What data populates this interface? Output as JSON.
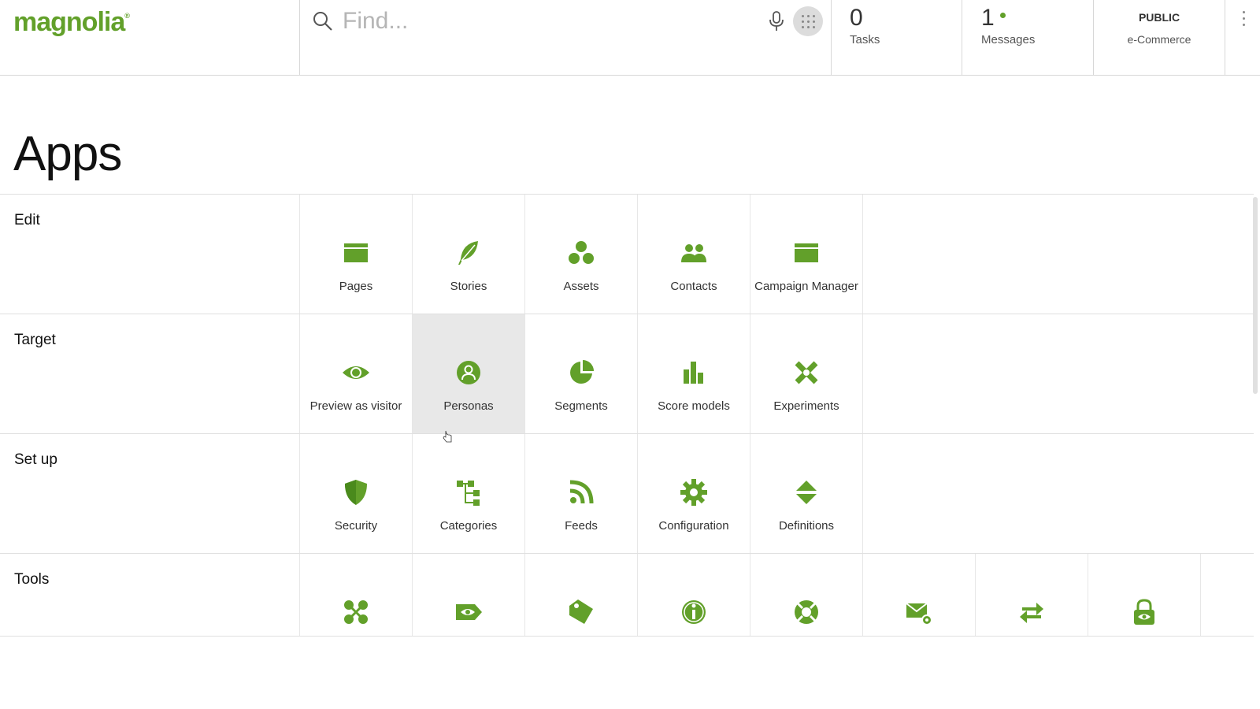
{
  "header": {
    "logo_text": "magnolia",
    "logo_mark": "®",
    "search": {
      "placeholder": "Find...",
      "value": ""
    },
    "tasks": {
      "count": "0",
      "label": "Tasks"
    },
    "messages": {
      "count": "1",
      "label": "Messages"
    },
    "environment": {
      "label": "PUBLIC",
      "site": "e-Commerce"
    }
  },
  "page": {
    "title": "Apps"
  },
  "accent_color": "#62a02a",
  "groups": [
    {
      "name": "Edit",
      "apps": [
        {
          "label": "Pages",
          "icon": "pages-icon"
        },
        {
          "label": "Stories",
          "icon": "feather-icon"
        },
        {
          "label": "Assets",
          "icon": "assets-icon"
        },
        {
          "label": "Contacts",
          "icon": "contacts-icon"
        },
        {
          "label": "Campaign Manager",
          "icon": "campaign-icon"
        }
      ]
    },
    {
      "name": "Target",
      "apps": [
        {
          "label": "Preview as visitor",
          "icon": "eye-icon"
        },
        {
          "label": "Personas",
          "icon": "persona-icon"
        },
        {
          "label": "Segments",
          "icon": "pie-icon"
        },
        {
          "label": "Score models",
          "icon": "bar-chart-icon"
        },
        {
          "label": "Experiments",
          "icon": "experiments-icon"
        }
      ]
    },
    {
      "name": "Set up",
      "apps": [
        {
          "label": "Security",
          "icon": "shield-icon"
        },
        {
          "label": "Categories",
          "icon": "tree-icon"
        },
        {
          "label": "Feeds",
          "icon": "rss-icon"
        },
        {
          "label": "Configuration",
          "icon": "gear-icon"
        },
        {
          "label": "Definitions",
          "icon": "definitions-icon"
        }
      ]
    },
    {
      "name": "Tools",
      "apps": [
        {
          "label": "",
          "icon": "nodes-icon"
        },
        {
          "label": "",
          "icon": "eye-tag-icon"
        },
        {
          "label": "",
          "icon": "tag-icon"
        },
        {
          "label": "",
          "icon": "info-icon"
        },
        {
          "label": "",
          "icon": "lifebuoy-icon"
        },
        {
          "label": "",
          "icon": "mail-gear-icon"
        },
        {
          "label": "",
          "icon": "swap-arrows-icon"
        },
        {
          "label": "",
          "icon": "lock-eye-icon"
        }
      ]
    }
  ]
}
